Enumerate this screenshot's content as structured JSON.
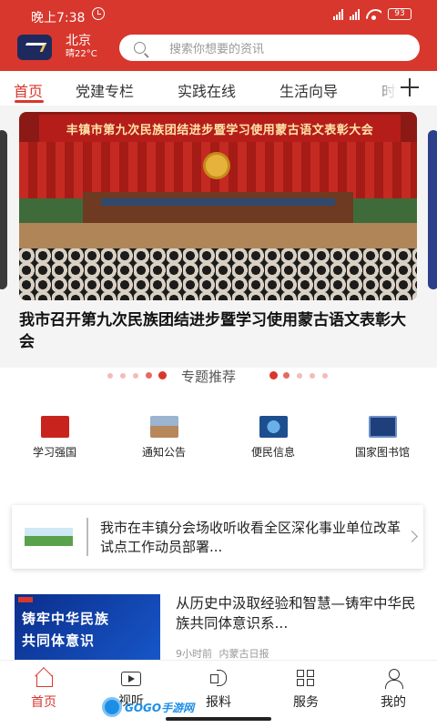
{
  "status": {
    "time": "晚上7:38",
    "battery": "93"
  },
  "header": {
    "city": "北京",
    "weather": "晴22°C",
    "search_placeholder": "搜索你想要的资讯"
  },
  "tabs": [
    "首页",
    "党建专栏",
    "实践在线",
    "生活向导",
    "时"
  ],
  "active_tab": 0,
  "hero": {
    "banner": "丰镇市第九次民族团结进步暨学习使用蒙古语文表彰大会",
    "title": "我市召开第九次民族团结进步暨学习使用蒙古语文表彰大会"
  },
  "section": {
    "title": "专题推荐"
  },
  "entries": [
    {
      "label": "学习强国",
      "icon": "xuexi-qiangguo-icon"
    },
    {
      "label": "通知公告",
      "icon": "notice-building-icon"
    },
    {
      "label": "便民信息",
      "icon": "globe-info-icon"
    },
    {
      "label": "国家图书馆",
      "icon": "national-library-icon"
    }
  ],
  "notice": {
    "text": "我市在丰镇分会场收听收看全区深化事业单位改革试点工作动员部署..."
  },
  "news": [
    {
      "thumb_line1": "铸牢中华民族",
      "thumb_line2": "共同体意识",
      "title": "从历史中汲取经验和智慧—铸牢中华民族共同体意识系...",
      "time": "9小时前",
      "source": "内蒙古日报"
    }
  ],
  "bottom_nav": [
    {
      "label": "首页",
      "icon": "home-icon"
    },
    {
      "label": "视听",
      "icon": "video-icon"
    },
    {
      "label": "报料",
      "icon": "report-icon"
    },
    {
      "label": "服务",
      "icon": "service-grid-icon"
    },
    {
      "label": "我的",
      "icon": "profile-icon"
    }
  ],
  "watermark": "GOGO手游网",
  "colors": {
    "accent": "#d8372d",
    "nav_blue": "#1e2a5e"
  }
}
